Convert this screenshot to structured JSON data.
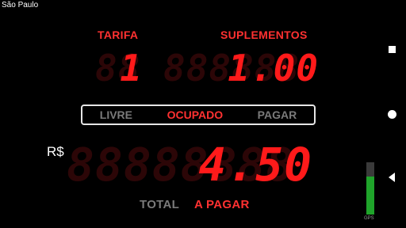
{
  "city": "São Paulo",
  "labels": {
    "tarifa": "TARIFA",
    "suplementos": "SUPLEMENTOS",
    "total": "TOTAL",
    "a_pagar": "A PAGAR",
    "currency": "R$"
  },
  "displays": {
    "tarifa": {
      "ghost": "88",
      "value": "1"
    },
    "suplementos": {
      "ghost": "888888",
      "value": "1.00"
    },
    "total": {
      "ghost": "88888888",
      "value": "4.50"
    }
  },
  "status": {
    "livre": "LIVRE",
    "ocupado": "OCUPADO",
    "pagar": "PAGAR",
    "active": "ocupado"
  },
  "gps": {
    "label": "GPS",
    "signal_fraction": 0.72
  },
  "colors": {
    "accent": "#ff1a1a",
    "inactive": "#7a7a7a",
    "gps": "#1fa42a"
  },
  "nav_icons": [
    "recents-square-icon",
    "home-circle-icon",
    "back-triangle-icon"
  ]
}
